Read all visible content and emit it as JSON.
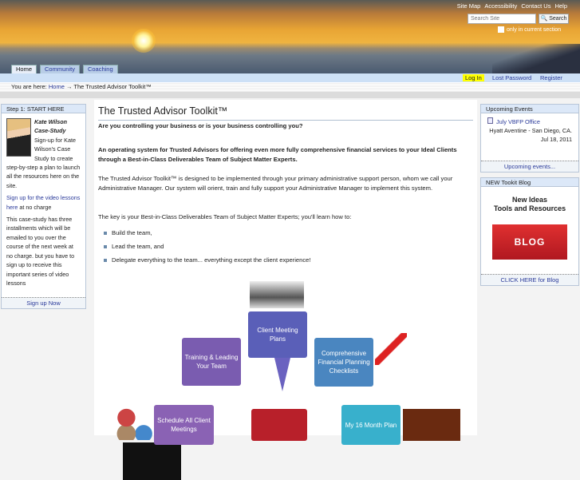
{
  "header": {
    "site_links": [
      "Site Map",
      "Accessibility",
      "Contact Us",
      "Help"
    ],
    "search_placeholder": "Search Site",
    "search_button": "Search",
    "only_current": "only in current section"
  },
  "tabs": [
    "Home",
    "Community",
    "Coaching"
  ],
  "userbar": {
    "login": "Log In",
    "lost_password": "Lost Password",
    "register": "Register"
  },
  "breadcrumb": {
    "prefix": "You are here:",
    "home": "Home",
    "arrow": "→",
    "current": "The Trusted Advisor Toolkit™"
  },
  "left": {
    "header": "Step 1: START HERE",
    "name": "Kate Wilson Case-Study",
    "intro": "Sign-up for Kate Wilson's Case Study to create step-by-step a plan to launch all the resources here on the site.",
    "link": "Sign up for the video lessons here",
    "link_suffix": " at no charge",
    "body": "This case-study has three installments which will be emailed to you over the course of the next week at no charge. but you have to sign up to receive this important series of video lessons",
    "footer": "Sign up Now"
  },
  "main": {
    "title": "The Trusted Advisor Toolkit™",
    "q": "Are you controlling your business or is your business controlling you?",
    "lead": "An operating system for Trusted Advisors for offering even more fully comprehensive financial services to your Ideal Clients through a Best-in-Class Deliverables Team of Subject Matter Experts.",
    "p1": "The Trusted Advisor Toolkit™ is designed to be implemented through your primary administrative support person, whom we call your Administrative Manager.  Our system will orient, train and fully support your Administrative Manager to implement this system.",
    "p2": "The key is your Best-in-Class Deliverables Team of Subject Matter Experts; you'll learn how to:",
    "bullets": [
      "Build the team,",
      "Lead the team, and",
      "Delegate everything to the team... everything except the client experience!"
    ],
    "diagram": {
      "plans": "Client Meeting Plans",
      "training": "Training & Leading Your Team",
      "checklists": "Comprehensive Financial Planning Checklists",
      "schedule": "Schedule All Client Meetings",
      "plan16": "My 16 Month Plan"
    }
  },
  "events": {
    "header": "Upcoming Events",
    "title": "July VBFP Office",
    "location": "Hyatt Aventine - San Diego, CA.",
    "date": "Jul 18, 2011",
    "footer": "Upcoming events..."
  },
  "blog": {
    "header": "NEW Tookit Blog",
    "line1": "New Ideas",
    "line2": "Tools and Resources",
    "box": "BLOG",
    "footer": "CLICK HERE for Blog"
  }
}
